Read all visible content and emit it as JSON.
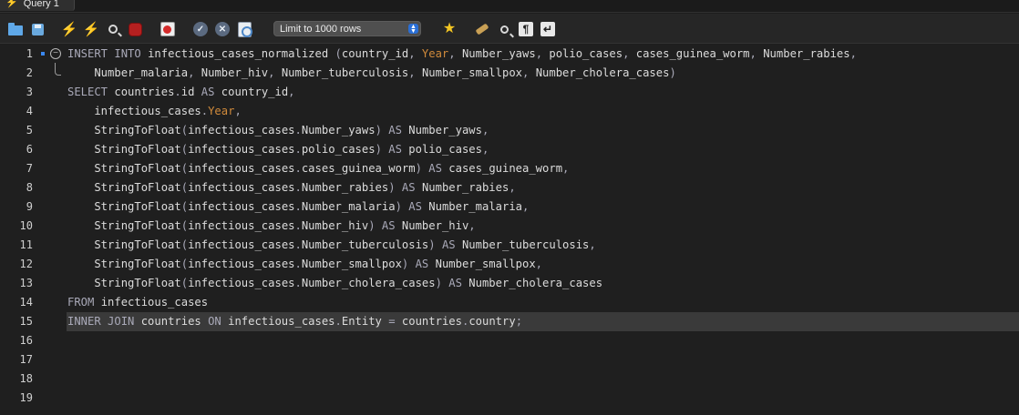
{
  "tab": {
    "label": "Query 1"
  },
  "toolbar": {
    "limit_label": "Limit to 1000 rows",
    "icons": [
      "folder-icon",
      "save-icon",
      "execute-icon",
      "execute-current-icon",
      "explain-icon",
      "stop-icon",
      "toggle-continue-icon",
      "commit-icon",
      "rollback-icon",
      "autocommit-icon",
      "beautify-icon",
      "clean-icon",
      "find-icon",
      "invisibles-icon",
      "wrap-icon"
    ],
    "accent": "#f2c200"
  },
  "editor": {
    "current_line": 15,
    "line_numbers": [
      "1",
      "2",
      "3",
      "4",
      "5",
      "6",
      "7",
      "8",
      "9",
      "10",
      "11",
      "12",
      "13",
      "14",
      "15",
      "16",
      "17",
      "18",
      "19"
    ],
    "lines": [
      [
        [
          "kw",
          "INSERT INTO "
        ],
        [
          "t",
          "infectious_cases_normalized "
        ],
        [
          "op",
          "("
        ],
        [
          "t",
          "country_id"
        ],
        [
          "op",
          ", "
        ],
        [
          "fld",
          "Year"
        ],
        [
          "op",
          ", "
        ],
        [
          "t",
          "Number_yaws"
        ],
        [
          "op",
          ", "
        ],
        [
          "t",
          "polio_cases"
        ],
        [
          "op",
          ", "
        ],
        [
          "t",
          "cases_guinea_worm"
        ],
        [
          "op",
          ", "
        ],
        [
          "t",
          "Number_rabies"
        ],
        [
          "op",
          ","
        ]
      ],
      [
        [
          "t",
          "    Number_malaria"
        ],
        [
          "op",
          ", "
        ],
        [
          "t",
          "Number_hiv"
        ],
        [
          "op",
          ", "
        ],
        [
          "t",
          "Number_tuberculosis"
        ],
        [
          "op",
          ", "
        ],
        [
          "t",
          "Number_smallpox"
        ],
        [
          "op",
          ", "
        ],
        [
          "t",
          "Number_cholera_cases"
        ],
        [
          "op",
          ")"
        ]
      ],
      [
        [
          "kw",
          "SELECT "
        ],
        [
          "t",
          "countries"
        ],
        [
          "op",
          "."
        ],
        [
          "t",
          "id "
        ],
        [
          "kw",
          "AS "
        ],
        [
          "t",
          "country_id"
        ],
        [
          "op",
          ","
        ]
      ],
      [
        [
          "t",
          "    infectious_cases"
        ],
        [
          "op",
          "."
        ],
        [
          "fld",
          "Year"
        ],
        [
          "op",
          ","
        ]
      ],
      [
        [
          "t",
          "    StringToFloat"
        ],
        [
          "op",
          "("
        ],
        [
          "t",
          "infectious_cases"
        ],
        [
          "op",
          "."
        ],
        [
          "t",
          "Number_yaws"
        ],
        [
          "op",
          ") "
        ],
        [
          "kw",
          "AS "
        ],
        [
          "t",
          "Number_yaws"
        ],
        [
          "op",
          ","
        ]
      ],
      [
        [
          "t",
          "    StringToFloat"
        ],
        [
          "op",
          "("
        ],
        [
          "t",
          "infectious_cases"
        ],
        [
          "op",
          "."
        ],
        [
          "t",
          "polio_cases"
        ],
        [
          "op",
          ") "
        ],
        [
          "kw",
          "AS "
        ],
        [
          "t",
          "polio_cases"
        ],
        [
          "op",
          ","
        ]
      ],
      [
        [
          "t",
          "    StringToFloat"
        ],
        [
          "op",
          "("
        ],
        [
          "t",
          "infectious_cases"
        ],
        [
          "op",
          "."
        ],
        [
          "t",
          "cases_guinea_worm"
        ],
        [
          "op",
          ") "
        ],
        [
          "kw",
          "AS "
        ],
        [
          "t",
          "cases_guinea_worm"
        ],
        [
          "op",
          ","
        ]
      ],
      [
        [
          "t",
          "    StringToFloat"
        ],
        [
          "op",
          "("
        ],
        [
          "t",
          "infectious_cases"
        ],
        [
          "op",
          "."
        ],
        [
          "t",
          "Number_rabies"
        ],
        [
          "op",
          ") "
        ],
        [
          "kw",
          "AS "
        ],
        [
          "t",
          "Number_rabies"
        ],
        [
          "op",
          ","
        ]
      ],
      [
        [
          "t",
          "    StringToFloat"
        ],
        [
          "op",
          "("
        ],
        [
          "t",
          "infectious_cases"
        ],
        [
          "op",
          "."
        ],
        [
          "t",
          "Number_malaria"
        ],
        [
          "op",
          ") "
        ],
        [
          "kw",
          "AS "
        ],
        [
          "t",
          "Number_malaria"
        ],
        [
          "op",
          ","
        ]
      ],
      [
        [
          "t",
          "    StringToFloat"
        ],
        [
          "op",
          "("
        ],
        [
          "t",
          "infectious_cases"
        ],
        [
          "op",
          "."
        ],
        [
          "t",
          "Number_hiv"
        ],
        [
          "op",
          ") "
        ],
        [
          "kw",
          "AS "
        ],
        [
          "t",
          "Number_hiv"
        ],
        [
          "op",
          ","
        ]
      ],
      [
        [
          "t",
          "    StringToFloat"
        ],
        [
          "op",
          "("
        ],
        [
          "t",
          "infectious_cases"
        ],
        [
          "op",
          "."
        ],
        [
          "t",
          "Number_tuberculosis"
        ],
        [
          "op",
          ") "
        ],
        [
          "kw",
          "AS "
        ],
        [
          "t",
          "Number_tuberculosis"
        ],
        [
          "op",
          ","
        ]
      ],
      [
        [
          "t",
          "    StringToFloat"
        ],
        [
          "op",
          "("
        ],
        [
          "t",
          "infectious_cases"
        ],
        [
          "op",
          "."
        ],
        [
          "t",
          "Number_smallpox"
        ],
        [
          "op",
          ") "
        ],
        [
          "kw",
          "AS "
        ],
        [
          "t",
          "Number_smallpox"
        ],
        [
          "op",
          ","
        ]
      ],
      [
        [
          "t",
          "    StringToFloat"
        ],
        [
          "op",
          "("
        ],
        [
          "t",
          "infectious_cases"
        ],
        [
          "op",
          "."
        ],
        [
          "t",
          "Number_cholera_cases"
        ],
        [
          "op",
          ") "
        ],
        [
          "kw",
          "AS "
        ],
        [
          "t",
          "Number_cholera_cases"
        ]
      ],
      [
        [
          "kw",
          "FROM "
        ],
        [
          "t",
          "infectious_cases"
        ]
      ],
      [
        [
          "kw",
          "INNER JOIN "
        ],
        [
          "t",
          "countries "
        ],
        [
          "kw",
          "ON "
        ],
        [
          "t",
          "infectious_cases"
        ],
        [
          "op",
          "."
        ],
        [
          "t",
          "Entity "
        ],
        [
          "op",
          "= "
        ],
        [
          "t",
          "countries"
        ],
        [
          "op",
          "."
        ],
        [
          "t",
          "country"
        ],
        [
          "op",
          ";"
        ]
      ],
      [],
      [],
      [],
      []
    ]
  }
}
